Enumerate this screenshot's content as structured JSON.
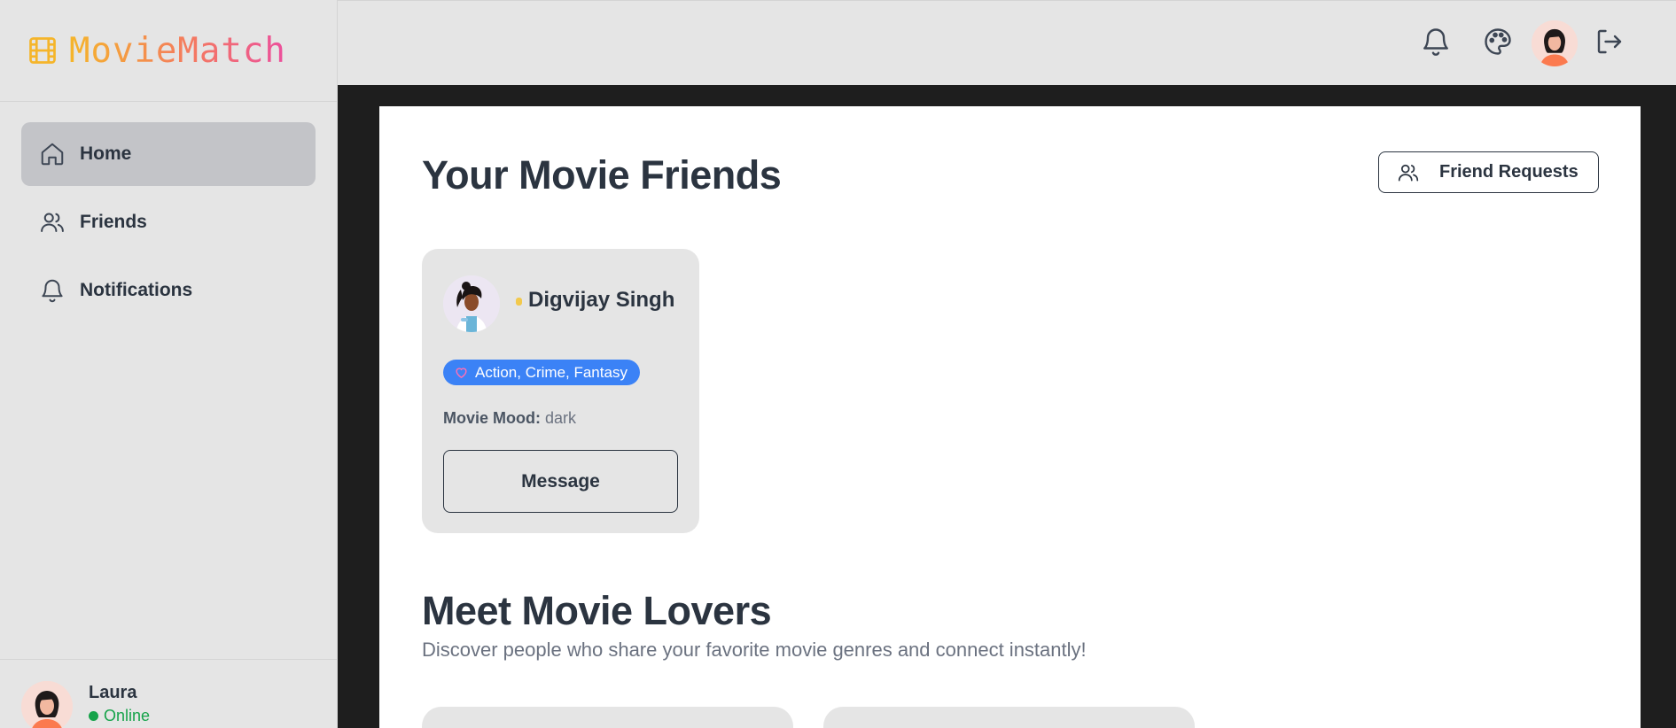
{
  "brand": {
    "name": "MovieMatch",
    "icon": "film-icon"
  },
  "sidebar": {
    "items": [
      {
        "label": "Home",
        "icon": "home-icon",
        "active": true
      },
      {
        "label": "Friends",
        "icon": "users-icon",
        "active": false
      },
      {
        "label": "Notifications",
        "icon": "bell-icon",
        "active": false
      }
    ]
  },
  "user": {
    "name": "Laura",
    "status": "Online"
  },
  "topbar": {
    "icons": [
      "bell-icon",
      "palette-icon",
      "avatar",
      "logout-icon"
    ]
  },
  "friends_section": {
    "title": "Your Movie Friends",
    "requests_label": "Friend Requests",
    "friends": [
      {
        "name": "Digvijay Singh",
        "genres": "Action, Crime, Fantasy",
        "mood_label": "Movie Mood:",
        "mood": "dark",
        "button_label": "Message"
      }
    ]
  },
  "lovers_section": {
    "title": "Meet Movie Lovers",
    "subtitle": "Discover people who share your favorite movie genres and connect instantly!"
  },
  "colors": {
    "accent": "#3b82f6",
    "online": "#16a34a",
    "brand_gradient": [
      "#f5b52a",
      "#f47b5f",
      "#ec4f9d"
    ]
  }
}
